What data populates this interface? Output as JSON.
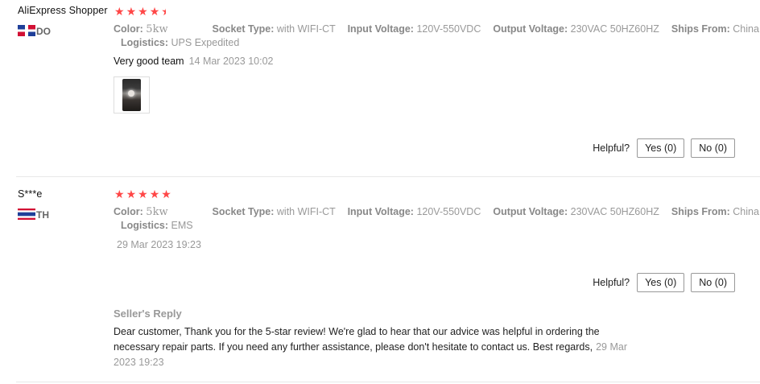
{
  "reviews": [
    {
      "reviewer": "AliExpress Shopper",
      "country": "DO",
      "rating": 4.5,
      "attributes": {
        "color_label": "Color:",
        "color_value": "5kw",
        "socket_label": "Socket Type:",
        "socket_value": "with WIFI-CT",
        "input_label": "Input Voltage:",
        "input_value": "120V-550VDC",
        "output_label": "Output Voltage:",
        "output_value": "230VAC 50HZ60HZ",
        "ships_label": "Ships From:",
        "ships_value": "China",
        "logistics_label": "Logistics:",
        "logistics_value": "UPS Expedited"
      },
      "text": "Very good team",
      "date": "14 Mar 2023 10:02",
      "helpful_label": "Helpful?",
      "yes_label": "Yes (0)",
      "no_label": "No (0)"
    },
    {
      "reviewer": "S***e",
      "country": "TH",
      "rating": 5,
      "attributes": {
        "color_label": "Color:",
        "color_value": "5kw",
        "socket_label": "Socket Type:",
        "socket_value": "with WIFI-CT",
        "input_label": "Input Voltage:",
        "input_value": "120V-550VDC",
        "output_label": "Output Voltage:",
        "output_value": "230VAC 50HZ60HZ",
        "ships_label": "Ships From:",
        "ships_value": "China",
        "logistics_label": "Logistics:",
        "logistics_value": "EMS"
      },
      "date": "29 Mar 2023 19:23",
      "helpful_label": "Helpful?",
      "yes_label": "Yes (0)",
      "no_label": "No (0)",
      "seller_reply": {
        "title": "Seller's Reply",
        "text": "Dear customer, Thank you for the 5-star review! We're glad to hear that our advice was helpful in ordering the necessary repair parts. If you need any further assistance, please don't hesitate to contact us. Best regards,",
        "date": "29 Mar 2023 19:23"
      }
    }
  ],
  "colors": {
    "star": "#ff4747",
    "muted": "#999999",
    "text": "#222222"
  }
}
